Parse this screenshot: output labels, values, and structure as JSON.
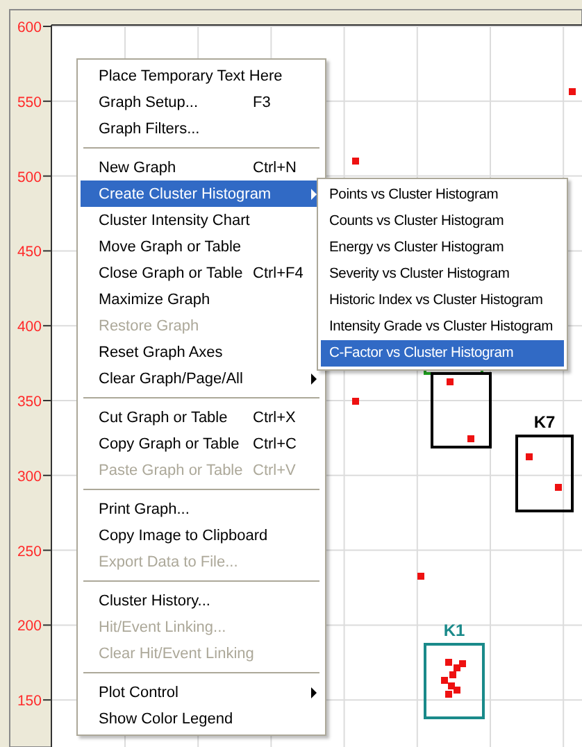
{
  "plot": {
    "y_ticks": [
      "600",
      "550",
      "500",
      "450",
      "400",
      "350",
      "300",
      "250",
      "200",
      "150"
    ],
    "clusters": [
      {
        "label": "K7",
        "color": "#000000"
      },
      {
        "label": "K1",
        "color": "#1a8a8a"
      }
    ]
  },
  "context_menu": {
    "groups": [
      [
        {
          "label": "Place Temporary Text Here",
          "disabled": false,
          "selected": false,
          "submenu": false
        },
        {
          "label": "Graph Setup...",
          "shortcut": "F3",
          "disabled": false,
          "selected": false,
          "submenu": false
        },
        {
          "label": "Graph Filters...",
          "disabled": false,
          "selected": false,
          "submenu": false
        }
      ],
      [
        {
          "label": "New Graph",
          "shortcut": "Ctrl+N",
          "disabled": false,
          "selected": false,
          "submenu": false
        },
        {
          "label": "Create Cluster Histogram",
          "disabled": false,
          "selected": true,
          "submenu": true
        },
        {
          "label": "Cluster Intensity Chart",
          "disabled": false,
          "selected": false,
          "submenu": false
        },
        {
          "label": "Move Graph or Table",
          "disabled": false,
          "selected": false,
          "submenu": false
        },
        {
          "label": "Close Graph or Table",
          "shortcut": "Ctrl+F4",
          "disabled": false,
          "selected": false,
          "submenu": false
        },
        {
          "label": "Maximize Graph",
          "disabled": false,
          "selected": false,
          "submenu": false
        },
        {
          "label": "Restore Graph",
          "disabled": true,
          "selected": false,
          "submenu": false
        },
        {
          "label": "Reset Graph Axes",
          "disabled": false,
          "selected": false,
          "submenu": false
        },
        {
          "label": "Clear Graph/Page/All",
          "disabled": false,
          "selected": false,
          "submenu": true
        }
      ],
      [
        {
          "label": "Cut Graph or Table",
          "shortcut": "Ctrl+X",
          "disabled": false,
          "selected": false,
          "submenu": false
        },
        {
          "label": "Copy Graph or Table",
          "shortcut": "Ctrl+C",
          "disabled": false,
          "selected": false,
          "submenu": false
        },
        {
          "label": "Paste Graph or Table",
          "shortcut": "Ctrl+V",
          "disabled": true,
          "selected": false,
          "submenu": false
        }
      ],
      [
        {
          "label": "Print Graph...",
          "disabled": false,
          "selected": false,
          "submenu": false
        },
        {
          "label": "Copy Image to Clipboard",
          "disabled": false,
          "selected": false,
          "submenu": false
        },
        {
          "label": "Export Data to File...",
          "disabled": true,
          "selected": false,
          "submenu": false
        }
      ],
      [
        {
          "label": "Cluster History...",
          "disabled": false,
          "selected": false,
          "submenu": false
        },
        {
          "label": "Hit/Event Linking...",
          "disabled": true,
          "selected": false,
          "submenu": false
        },
        {
          "label": "Clear Hit/Event Linking",
          "disabled": true,
          "selected": false,
          "submenu": false
        }
      ],
      [
        {
          "label": "Plot Control",
          "disabled": false,
          "selected": false,
          "submenu": true
        },
        {
          "label": "Show Color Legend",
          "disabled": false,
          "selected": false,
          "submenu": false
        }
      ]
    ]
  },
  "submenu": {
    "items": [
      {
        "label": "Points vs Cluster Histogram",
        "selected": false
      },
      {
        "label": "Counts vs Cluster Histogram",
        "selected": false
      },
      {
        "label": "Energy vs Cluster Histogram",
        "selected": false
      },
      {
        "label": "Severity vs Cluster Histogram",
        "selected": false
      },
      {
        "label": "Historic Index vs Cluster Histogram",
        "selected": false
      },
      {
        "label": "Intensity Grade vs Cluster Histogram",
        "selected": false
      },
      {
        "label": "C-Factor vs Cluster Histogram",
        "selected": true
      }
    ]
  }
}
